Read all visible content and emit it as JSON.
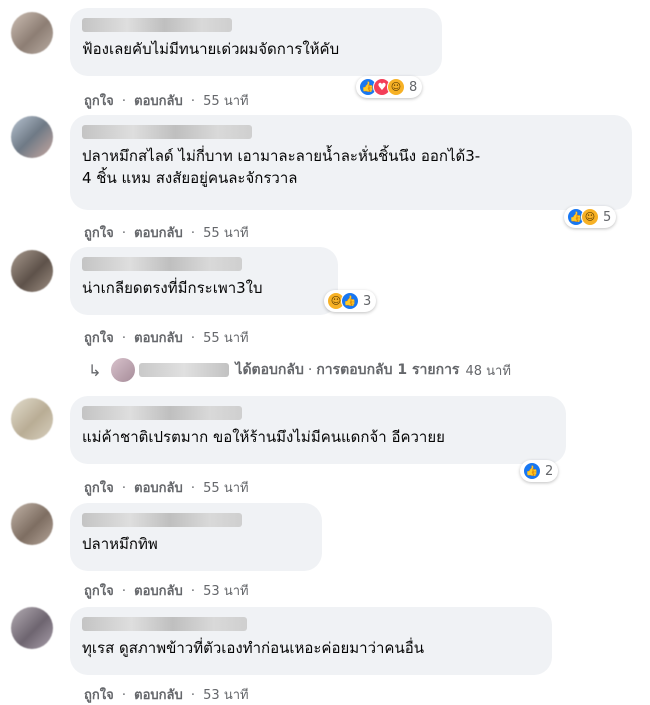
{
  "comments": [
    {
      "text_lines": [
        "ฟ้องเลยคับไม่มีทนายเด่วผมจัดการให้คับ"
      ],
      "reaction_count": "8",
      "like": "ถูกใจ",
      "reply": "ตอบกลับ",
      "time": "55 นาที"
    },
    {
      "text_lines": [
        "ปลาหมึกสไลด์ ไม่กี่บาท เอามาละลายน้ำละหั่นชิ้นนึง ออกได้3-",
        "4 ชิ้น แหม สงสัยอยู่คนละจักรวาล"
      ],
      "reaction_count": "5",
      "like": "ถูกใจ",
      "reply": "ตอบกลับ",
      "time": "55 นาที"
    },
    {
      "text_lines": [
        "น่าเกลียดตรงที่มีกระเพา3ใบ"
      ],
      "reaction_count": "3",
      "like": "ถูกใจ",
      "reply": "ตอบกลับ",
      "time": "55 นาที"
    },
    {
      "text_lines": [
        "แม่ค้าชาติเปรตมาก ขอให้ร้านมึงไม่มีคนแดกจ้า อีควายย"
      ],
      "reaction_count": "2",
      "like": "ถูกใจ",
      "reply": "ตอบกลับ",
      "time": "55 นาที"
    },
    {
      "text_lines": [
        "ปลาหมึกทิพ"
      ],
      "reaction_count": "",
      "like": "ถูกใจ",
      "reply": "ตอบกลับ",
      "time": "53 นาที"
    },
    {
      "text_lines": [
        "ทุเรส ดูสภาพข้าวที่ตัวเองทำก่อนเหอะค่อยมาว่าคนอื่น"
      ],
      "reaction_count": "",
      "like": "ถูกใจ",
      "reply": "ตอบกลับ",
      "time": "53 นาที"
    }
  ],
  "reply_summary": {
    "arrow": "↳",
    "replied": "ได้ตอบกลับ",
    "sep": "·",
    "count_text": "การตอบกลับ 1 รายการ",
    "time": "48 นาที"
  },
  "dot": "·",
  "colors": {
    "bubble": "#f0f2f5",
    "meta": "#65676b",
    "like_blue": "#1877f2"
  }
}
